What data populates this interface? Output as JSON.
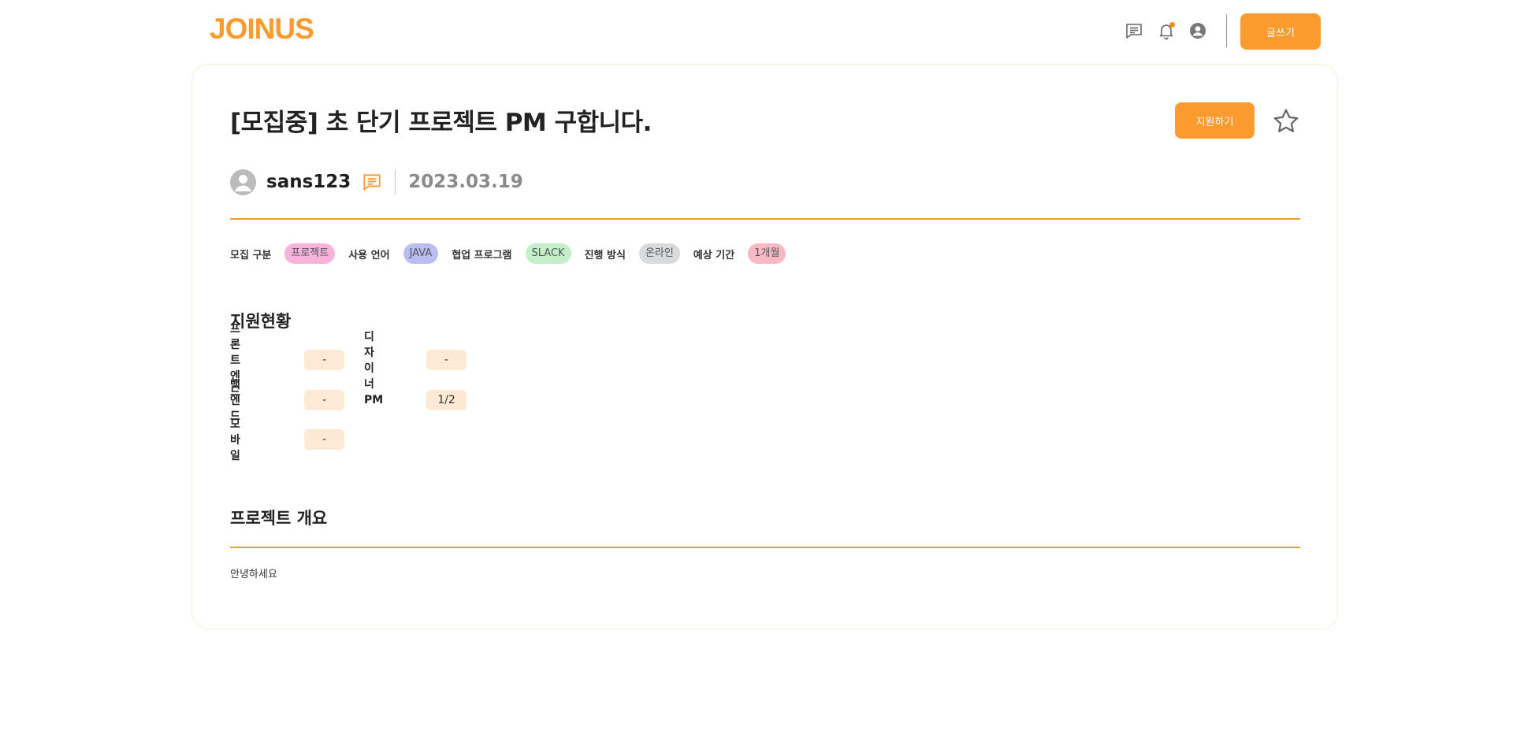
{
  "header": {
    "logo": "JOINUS",
    "write_button": "글쓰기"
  },
  "post": {
    "title": "[모집중] 초 단기 프로젝트 PM 구합니다.",
    "apply_button": "지원하기",
    "author": "sans123",
    "date": "2023.03.19"
  },
  "tags": [
    {
      "label": "모집 구분",
      "value": "프로젝트",
      "color": "#f7b3dc"
    },
    {
      "label": "사용 언어",
      "value": "JAVA",
      "color": "#b9bdf1"
    },
    {
      "label": "협업 프로그램",
      "value": "SLACK",
      "color": "#c3efc9"
    },
    {
      "label": "진행 방식",
      "value": "온라인",
      "color": "#d9dadb"
    },
    {
      "label": "예상 기간",
      "value": "1개월",
      "color": "#f8b9c4"
    }
  ],
  "status": {
    "title": "지원현황",
    "roles": [
      {
        "name": "프론트엔드",
        "count": "-"
      },
      {
        "name": "디자이너",
        "count": "-"
      },
      {
        "name": "백엔드",
        "count": "-"
      },
      {
        "name": "PM",
        "count": "1/2"
      },
      {
        "name": "모바일",
        "count": "-"
      }
    ]
  },
  "overview": {
    "title": "프로젝트 개요",
    "body": "안녕하세요"
  },
  "colors": {
    "accent": "#fb9a2d",
    "card_border": "#fdebd6",
    "count_bg": "#fde9d4"
  }
}
